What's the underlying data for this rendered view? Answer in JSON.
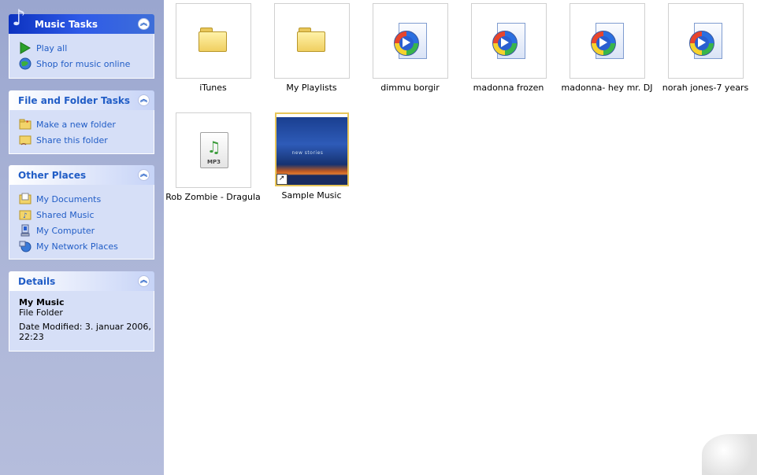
{
  "sidebar": {
    "music_tasks": {
      "title": "Music Tasks",
      "items": [
        {
          "label": "Play all",
          "icon": "play-icon"
        },
        {
          "label": "Shop for music online",
          "icon": "globe-icon"
        }
      ]
    },
    "file_folder_tasks": {
      "title": "File and Folder Tasks",
      "items": [
        {
          "label": "Make a new folder",
          "icon": "new-folder-icon"
        },
        {
          "label": "Share this folder",
          "icon": "share-folder-icon"
        }
      ]
    },
    "other_places": {
      "title": "Other Places",
      "items": [
        {
          "label": "My Documents",
          "icon": "my-documents-icon"
        },
        {
          "label": "Shared Music",
          "icon": "shared-music-icon"
        },
        {
          "label": "My Computer",
          "icon": "my-computer-icon"
        },
        {
          "label": "My Network Places",
          "icon": "network-places-icon"
        }
      ]
    },
    "details": {
      "title": "Details",
      "name": "My Music",
      "type": "File Folder",
      "modified": "Date Modified: 3. januar 2006,",
      "modified_time": "22:23"
    }
  },
  "files": [
    {
      "label": "iTunes",
      "kind": "folder"
    },
    {
      "label": "My Playlists",
      "kind": "folder"
    },
    {
      "label": "dimmu borgir",
      "kind": "wmp"
    },
    {
      "label": "madonna frozen",
      "kind": "wmp"
    },
    {
      "label": "madonna- hey mr. DJ",
      "kind": "wmp"
    },
    {
      "label": "norah jones-7 years",
      "kind": "wmp"
    },
    {
      "label": "Rob Zombie - Dragula",
      "kind": "mp3",
      "badge": "MP3"
    },
    {
      "label": "Sample Music",
      "kind": "shortcut-folder",
      "caption": "new stories"
    }
  ]
}
